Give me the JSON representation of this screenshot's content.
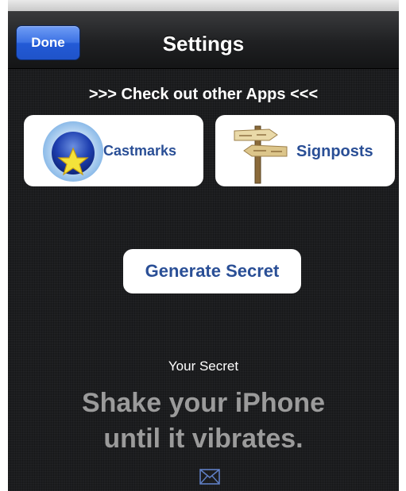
{
  "navbar": {
    "done_label": "Done",
    "title": "Settings"
  },
  "apps": {
    "header": ">>> Check out other Apps  <<<",
    "items": [
      {
        "label": "Castmarks",
        "icon": "castmarks-star-icon"
      },
      {
        "label": "Signposts",
        "icon": "signposts-icon"
      }
    ]
  },
  "generate_label": "Generate Secret",
  "secret": {
    "label": "Your Secret",
    "message_line1": "Shake your iPhone",
    "message_line2": "until it vibrates.",
    "share_icon": "envelope-icon"
  },
  "colors": {
    "accent_blue": "#3d73e4",
    "link_text": "#2a4f96",
    "background": "#1c1d1f",
    "hint_text": "#9b9b9b"
  }
}
